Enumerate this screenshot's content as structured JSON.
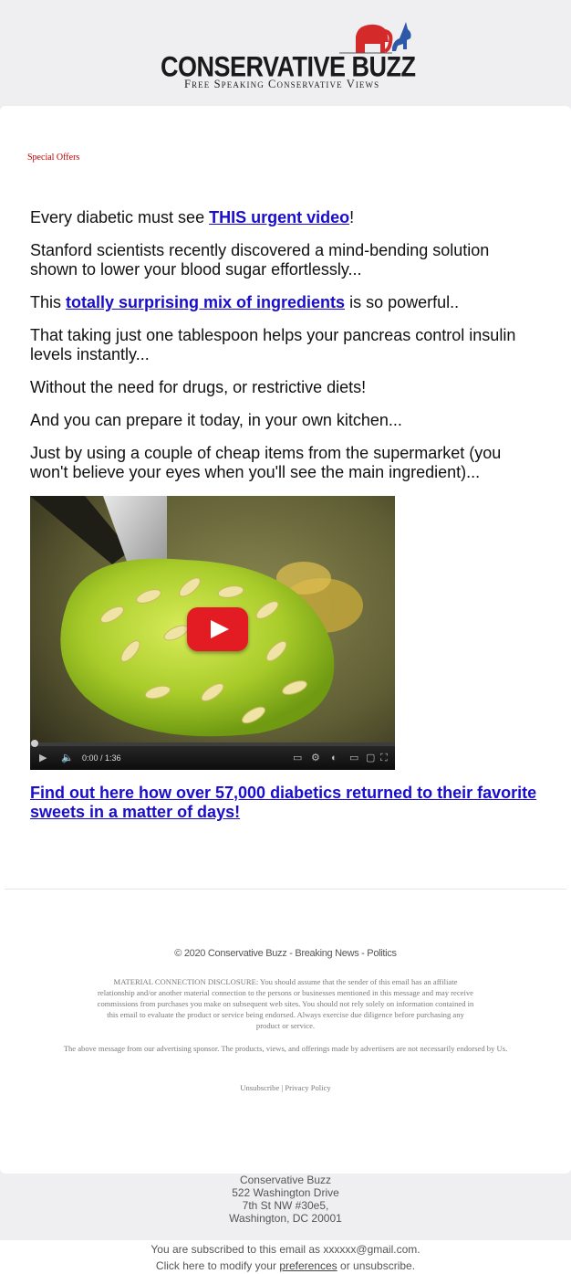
{
  "header": {
    "logo_title": "CONSERVATIVE BUZZ",
    "logo_tagline": "Free Speaking Conservative Views"
  },
  "special_offers": "Special Offers",
  "body": {
    "p1_before": "Every diabetic must see ",
    "p1_link": "THIS urgent video",
    "p1_after": "!",
    "p2": "Stanford scientists recently discovered a mind-bending solution shown to lower your blood sugar effortlessly...",
    "p3_before": "This ",
    "p3_link": "totally surprising mix of ingredients",
    "p3_after": " is so powerful..",
    "p4": "That taking just one tablespoon helps your pancreas control insulin levels instantly...",
    "p5": "Without the need for drugs, or restrictive diets!",
    "p6": "And you can prepare it today, in your own kitchen...",
    "p7": "Just by using a couple of cheap items from the supermarket (you won't believe your eyes when you'll see the main ingredient)..."
  },
  "video": {
    "time": "0:00 / 1:36",
    "play_color": "#e31b23"
  },
  "cta": "Find out here how over 57,000 diabetics returned to their favorite sweets in a matter of days!",
  "footer": {
    "copyright": "© 2020 Conservative Buzz - Breaking News - Politics",
    "disclosure": "MATERIAL CONNECTION DISCLOSURE: You should assume that the sender of this email has an affiliate relationship and/or another material connection to the persons or businesses mentioned in this message and may receive commissions from purchases you make on subsequent web sites. You should not rely solely on information contained in this email to evaluate the product or service being endorsed. Always exercise due diligence before purchasing any product or service.",
    "sponsor": "The above message from our advertising sponsor. The products, views, and offerings made by advertisers are not necessarily endorsed by Us.",
    "unsubscribe": "Unsubscribe",
    "separator": "|",
    "privacy": "Privacy Policy"
  },
  "address": {
    "name": "Conservative Buzz",
    "line1": "522 Washington Drive",
    "line2": "7th St NW #30e5,",
    "line3": "Washington, DC 20001"
  },
  "subscription": {
    "line1": "You are subscribed to this email as xxxxxx@gmail.com.",
    "line2_before": "Click here to modify your ",
    "line2_link": "preferences",
    "line2_after": " or unsubscribe."
  },
  "colors": {
    "link": "#1a0dcc",
    "special_offers": "#c00000",
    "background": "#efeff1",
    "logo_red": "#d42a2a",
    "logo_blue": "#2d5aa6"
  }
}
